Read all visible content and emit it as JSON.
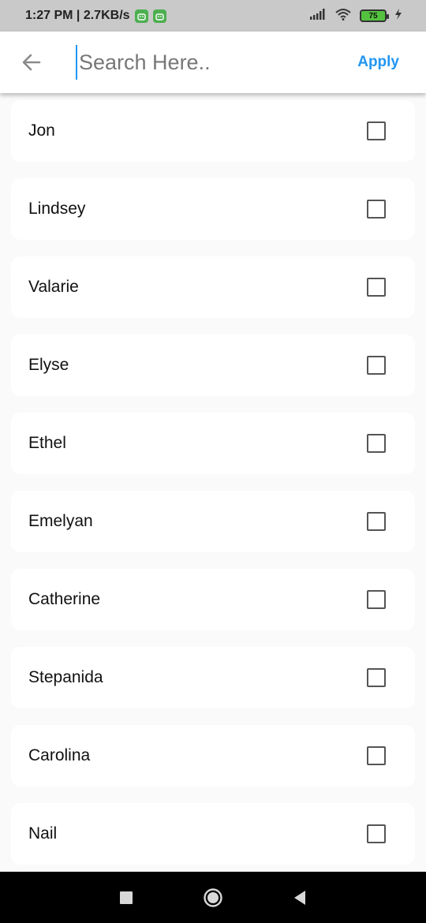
{
  "status_bar": {
    "time_speed": "1:27 PM | 2.7KB/s",
    "battery_level": "75",
    "icons": [
      "android-app-icon",
      "android-app-icon",
      "signal-icon",
      "wifi-icon",
      "battery-icon",
      "charging-icon"
    ]
  },
  "app_bar": {
    "search_placeholder": "Search Here..",
    "search_value": "",
    "apply_label": "Apply",
    "accent_color": "#2196f3"
  },
  "items": [
    {
      "label": "Jon",
      "checked": false
    },
    {
      "label": "Lindsey",
      "checked": false
    },
    {
      "label": "Valarie",
      "checked": false
    },
    {
      "label": "Elyse",
      "checked": false
    },
    {
      "label": "Ethel",
      "checked": false
    },
    {
      "label": "Emelyan",
      "checked": false
    },
    {
      "label": "Catherine",
      "checked": false
    },
    {
      "label": "Stepanida",
      "checked": false
    },
    {
      "label": "Carolina",
      "checked": false
    },
    {
      "label": "Nail",
      "checked": false
    }
  ],
  "nav_bar": {
    "buttons": [
      "recents-button",
      "home-button",
      "back-button"
    ]
  }
}
